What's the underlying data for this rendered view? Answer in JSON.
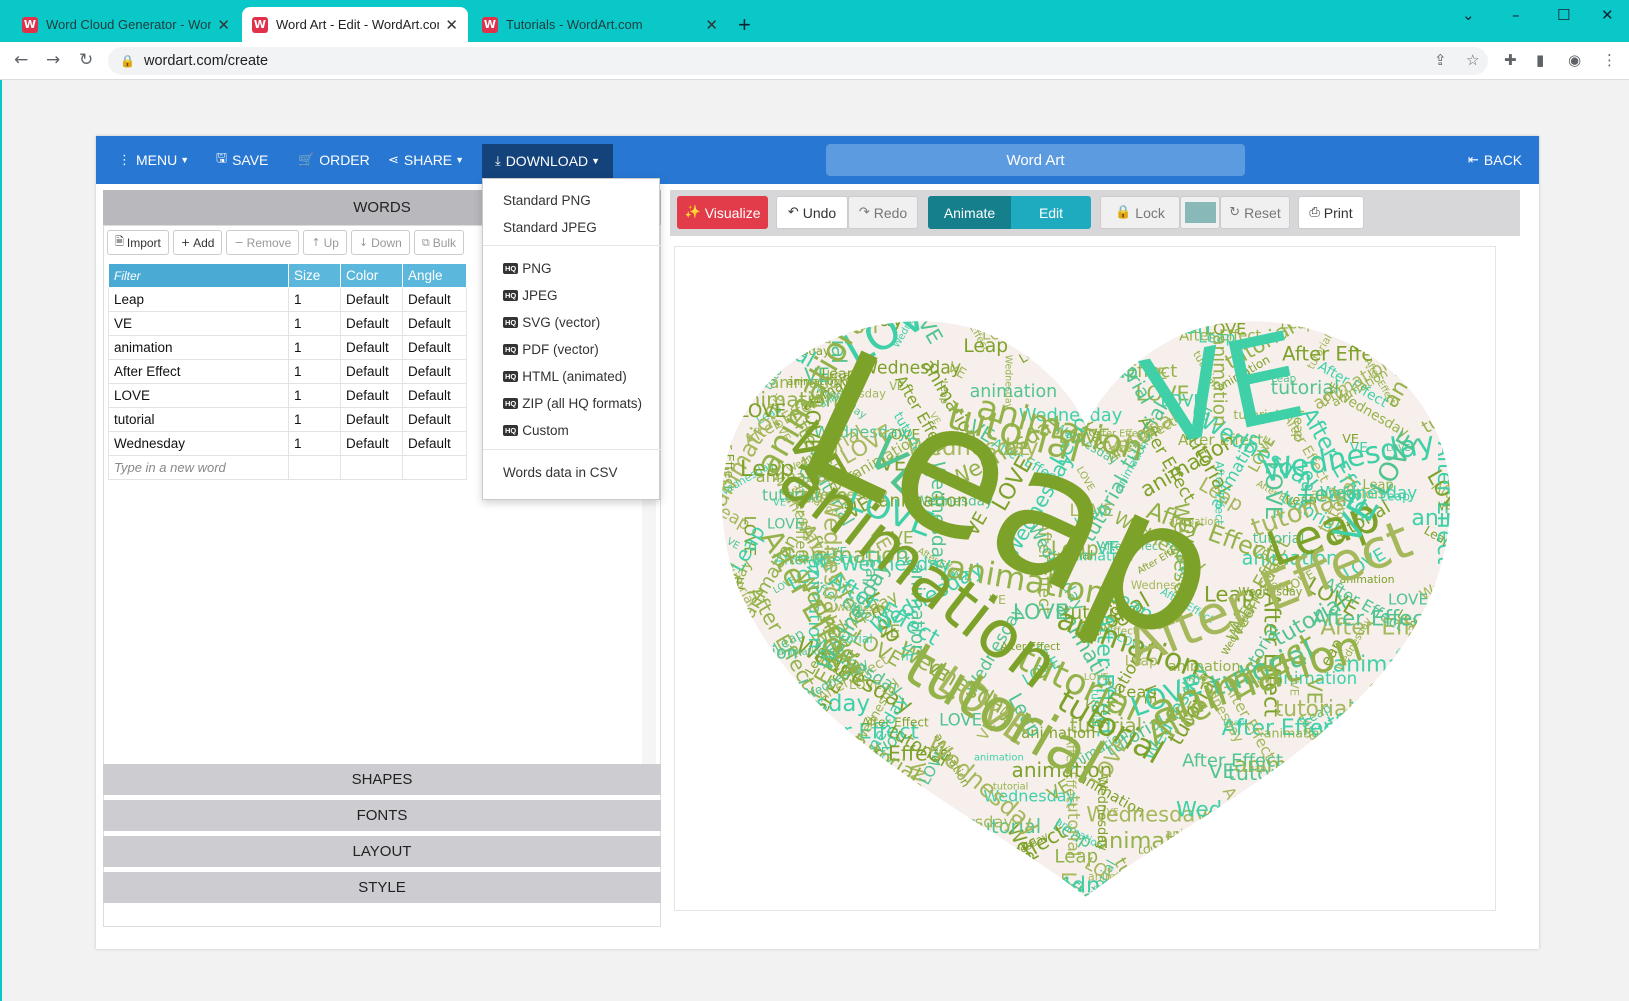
{
  "browser": {
    "tabs": [
      {
        "title": "Word Cloud Generator - WordArt.com",
        "active": false
      },
      {
        "title": "Word Art - Edit - WordArt.com",
        "active": true
      },
      {
        "title": "Tutorials - WordArt.com",
        "active": false
      }
    ],
    "url": "wordart.com/create",
    "favicon_letter": "W"
  },
  "toolbar": {
    "menu": "MENU",
    "save": "SAVE",
    "order": "ORDER",
    "share": "SHARE",
    "download": "DOWNLOAD",
    "title": "Word Art",
    "back": "BACK"
  },
  "words_panel": {
    "header": "WORDS",
    "tools": {
      "import": "Import",
      "add": "Add",
      "remove": "Remove",
      "up": "Up",
      "down": "Down",
      "bulk": "Bulk"
    },
    "columns": {
      "filter": "Filter",
      "size": "Size",
      "color": "Color",
      "angle": "Angle"
    },
    "rows": [
      {
        "word": "Leap",
        "size": "1",
        "color": "Default",
        "angle": "Default"
      },
      {
        "word": "VE",
        "size": "1",
        "color": "Default",
        "angle": "Default"
      },
      {
        "word": "animation",
        "size": "1",
        "color": "Default",
        "angle": "Default"
      },
      {
        "word": "After Effect",
        "size": "1",
        "color": "Default",
        "angle": "Default"
      },
      {
        "word": "LOVE",
        "size": "1",
        "color": "Default",
        "angle": "Default"
      },
      {
        "word": "tutorial",
        "size": "1",
        "color": "Default",
        "angle": "Default"
      },
      {
        "word": "Wednesday",
        "size": "1",
        "color": "Default",
        "angle": "Default"
      }
    ],
    "new_word_placeholder": "Type in a new word"
  },
  "accordion": {
    "shapes": "SHAPES",
    "fonts": "FONTS",
    "layout": "LAYOUT",
    "style": "STYLE"
  },
  "canvas_tools": {
    "visualize": "Visualize",
    "undo": "Undo",
    "redo": "Redo",
    "animate": "Animate",
    "edit": "Edit",
    "lock": "Lock",
    "reset": "Reset",
    "print": "Print",
    "swatch_color": "#88b8b8"
  },
  "download_menu": {
    "standard": [
      "Standard PNG",
      "Standard JPEG"
    ],
    "hq_badge": "HQ",
    "hq": [
      "PNG",
      "JPEG",
      "SVG (vector)",
      "PDF (vector)",
      "HTML (animated)",
      "ZIP (all HQ formats)",
      "Custom"
    ],
    "csv": "Words data in CSV"
  },
  "wordcloud": {
    "shape": "heart",
    "colors": [
      "#7da22a",
      "#3fd0a8",
      "#93b34a",
      "#52c48f",
      "#a5b85c"
    ],
    "words": [
      "Leap",
      "VE",
      "animation",
      "After Effect",
      "LOVE",
      "tutorial",
      "Wednesday"
    ]
  }
}
